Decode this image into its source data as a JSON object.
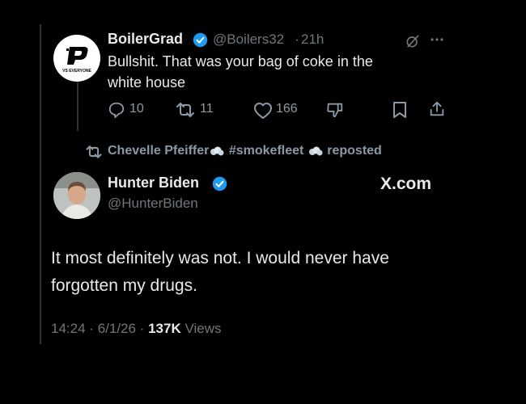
{
  "tweet": {
    "author_name": "BoilerGrad",
    "author_handle": "@Boilers32",
    "separator": "·",
    "time_ago": "21h",
    "avatar_text": "VS EVERYONE",
    "text_line1": "Bullshit. That was your bag of coke in the",
    "text_line2": "white house",
    "replies": "10",
    "reposts": "11",
    "likes": "166"
  },
  "repost_bar": {
    "user": "Chevelle Pfeiffer",
    "tag": "#smokefleet",
    "action": "reposted"
  },
  "reply": {
    "author_name": "Hunter Biden",
    "author_handle": "@HunterBiden",
    "watermark": "X.com",
    "text_line1": "It most definitely was not. I would never have",
    "text_line2": "forgotten my drugs.",
    "time": "14:24",
    "date": "6/1/26",
    "views_count": "137K",
    "views_label": "Views",
    "dot": "·"
  },
  "colors": {
    "background": "#000000",
    "text_primary": "#e7e9ea",
    "text_secondary": "#71767b",
    "verified_blue": "#1d9bf0"
  }
}
